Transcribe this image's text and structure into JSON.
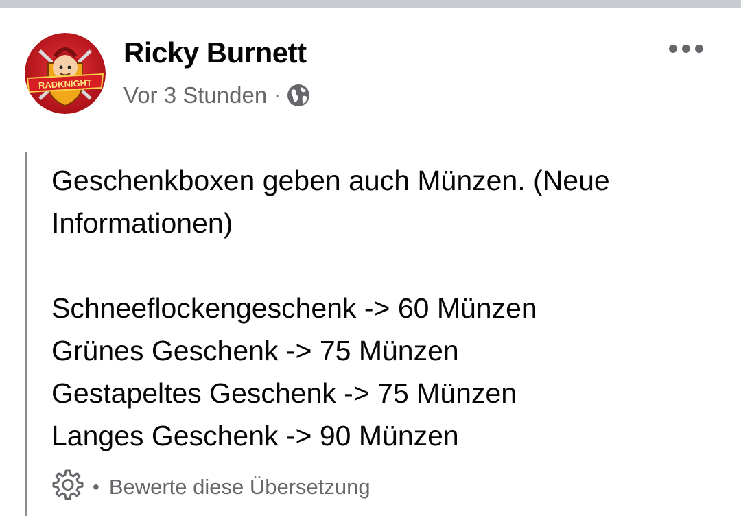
{
  "post": {
    "author": {
      "name": "Ricky Burnett",
      "avatar_text": "RADKNIGHT"
    },
    "meta": {
      "time": "Vor 3 Stunden",
      "separator": "·",
      "audience_icon": "globe-icon"
    },
    "more_icon": "more-dots-icon",
    "content": {
      "line1": "Geschenkboxen geben auch Münzen. (Neue",
      "line2": "Informationen)",
      "items": [
        "Schneeflockengeschenk -> 60 Münzen",
        "Grünes Geschenk -> 75 Münzen",
        "Gestapeltes Geschenk -> 75 Münzen",
        "Langes Geschenk -> 90 Münzen"
      ]
    },
    "translation": {
      "icon": "gear-icon",
      "separator": "•",
      "rate_label": "Bewerte diese Übersetzung"
    }
  },
  "colors": {
    "text_primary": "#050505",
    "text_secondary": "#65676b",
    "divider": "#c9ccd1",
    "avatar_red": "#c8161d"
  }
}
